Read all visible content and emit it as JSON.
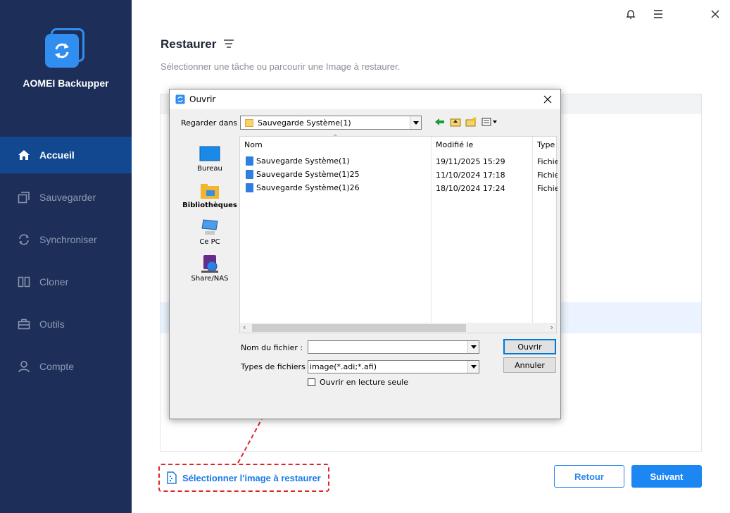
{
  "app": {
    "brand": "AOMEI Backupper"
  },
  "sidebar": {
    "items": [
      {
        "label": "Accueil",
        "icon": "home-icon",
        "active": true
      },
      {
        "label": "Sauvegarder",
        "icon": "backup-icon",
        "active": false
      },
      {
        "label": "Synchroniser",
        "icon": "sync-icon",
        "active": false
      },
      {
        "label": "Cloner",
        "icon": "clone-icon",
        "active": false
      },
      {
        "label": "Outils",
        "icon": "toolbox-icon",
        "active": false
      },
      {
        "label": "Compte",
        "icon": "user-icon",
        "active": false
      }
    ]
  },
  "header": {
    "title": "Restaurer",
    "subtitle": "Sélectionner une tâche ou parcourir une Image à restaurer."
  },
  "actions": {
    "select_image": "Sélectionner l'image à restaurer",
    "back": "Retour",
    "next": "Suivant"
  },
  "dialog": {
    "title": "Ouvrir",
    "look_in_label": "Regarder dans :",
    "look_in_value": "Sauvegarde Système(1)",
    "places": [
      "Bureau",
      "Bibliothèques",
      "Ce PC",
      "Share/NAS"
    ],
    "columns": [
      "Nom",
      "Modifié le",
      "Type"
    ],
    "files": [
      {
        "name": "Sauvegarde Système(1)",
        "modified": "19/11/2025 15:29",
        "type": "Fichie"
      },
      {
        "name": "Sauvegarde Système(1)25",
        "modified": "11/10/2024 17:18",
        "type": "Fichie"
      },
      {
        "name": "Sauvegarde Système(1)26",
        "modified": "18/10/2024 17:24",
        "type": "Fichie"
      }
    ],
    "filename_label": "Nom du fichier :",
    "filename_value": "",
    "filetype_label": "Types de fichiers :",
    "filetype_value": "image(*.adi;*.afi)",
    "readonly_label": "Ouvrir en lecture seule",
    "open_button": "Ouvrir",
    "cancel_button": "Annuler"
  },
  "colors": {
    "sidebar_bg": "#1d2f58",
    "sidebar_active": "#12488f",
    "accent": "#1c86f2",
    "highlight_dashed": "#e0262c"
  }
}
